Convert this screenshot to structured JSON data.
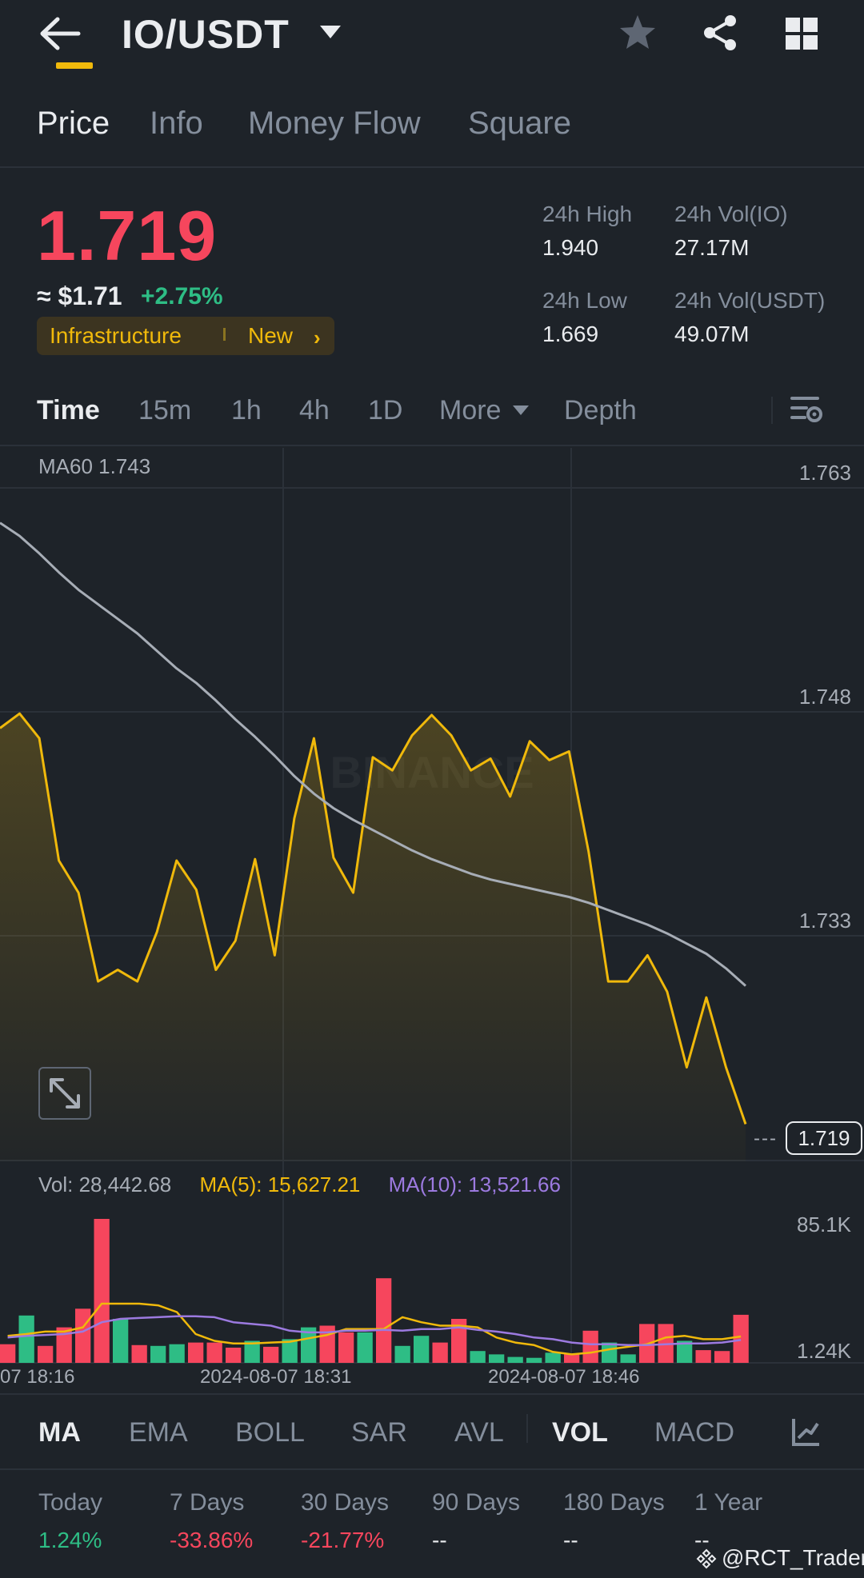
{
  "header": {
    "pair": "IO/USDT",
    "icons": [
      "back-arrow-icon",
      "caret-down-icon",
      "star-icon",
      "share-icon",
      "grid-icon"
    ]
  },
  "tabs": [
    {
      "label": "Price",
      "active": true
    },
    {
      "label": "Info",
      "active": false
    },
    {
      "label": "Money Flow",
      "active": false
    },
    {
      "label": "Square",
      "active": false
    }
  ],
  "ticker": {
    "last_price": "1.719",
    "usd_approx": "≈ $1.71",
    "change_pct": "+2.75%",
    "tag_category": "Infrastructure",
    "tag_new": "New",
    "high_label": "24h High",
    "high_value": "1.940",
    "low_label": "24h Low",
    "low_value": "1.669",
    "vol_io_label": "24h Vol(IO)",
    "vol_io_value": "27.17M",
    "vol_usdt_label": "24h Vol(USDT)",
    "vol_usdt_value": "49.07M"
  },
  "intervals": [
    {
      "label": "Time",
      "active": true
    },
    {
      "label": "15m",
      "active": false
    },
    {
      "label": "1h",
      "active": false
    },
    {
      "label": "4h",
      "active": false
    },
    {
      "label": "1D",
      "active": false
    },
    {
      "label": "More",
      "active": false
    },
    {
      "label": "Depth",
      "active": false
    }
  ],
  "chart_overlay": {
    "ma60_label": "MA60 1.743",
    "last_price_marker": "1.719",
    "watermark": "BINANCE"
  },
  "volume_legend": {
    "vol": "Vol: 28,442.68",
    "ma5": "MA(5): 15,627.21",
    "ma10": "MA(10): 13,521.66"
  },
  "indicators": {
    "main": [
      {
        "label": "MA",
        "active": true
      },
      {
        "label": "EMA",
        "active": false
      },
      {
        "label": "BOLL",
        "active": false
      },
      {
        "label": "SAR",
        "active": false
      },
      {
        "label": "AVL",
        "active": false
      }
    ],
    "sub": [
      {
        "label": "VOL",
        "active": true
      },
      {
        "label": "MACD",
        "active": false
      }
    ]
  },
  "performance": [
    {
      "label": "Today",
      "value": "1.24%",
      "color": "#2ebd85"
    },
    {
      "label": "7 Days",
      "value": "-33.86%",
      "color": "#f6465d"
    },
    {
      "label": "30 Days",
      "value": "-21.77%",
      "color": "#f6465d"
    },
    {
      "label": "90 Days",
      "value": "--",
      "color": "#eaecef"
    },
    {
      "label": "180 Days",
      "value": "--",
      "color": "#eaecef"
    },
    {
      "label": "1 Year",
      "value": "--",
      "color": "#eaecef"
    }
  ],
  "watermark_handle": "@RCT_Traders",
  "colors": {
    "up": "#2ebd85",
    "down": "#f6465d",
    "accent": "#f0b90b",
    "ma10": "#9c7ae0",
    "ma60": "#a7adb6",
    "background": "#1e2329"
  },
  "chart_data": [
    {
      "type": "area",
      "title": "",
      "ylim": [
        1.719,
        1.763
      ],
      "y_ticks": [
        "1.763",
        "1.748",
        "1.733",
        "1.719"
      ],
      "grid": true,
      "series": [
        {
          "name": "Price",
          "values": [
            1.7465,
            1.7475,
            1.7458,
            1.7374,
            1.7352,
            1.7291,
            1.7299,
            1.7291,
            1.7325,
            1.7374,
            1.7354,
            1.7299,
            1.7319,
            1.7375,
            1.7309,
            1.7403,
            1.7458,
            1.7376,
            1.7352,
            1.7445,
            1.7436,
            1.746,
            1.7474,
            1.746,
            1.7436,
            1.7444,
            1.7418,
            1.7456,
            1.7443,
            1.7449,
            1.738,
            1.7291,
            1.7291,
            1.7309,
            1.7284,
            1.7232,
            1.728,
            1.7232,
            1.7193
          ]
        },
        {
          "name": "MA60",
          "values": [
            1.7606,
            1.7597,
            1.7585,
            1.7572,
            1.756,
            1.755,
            1.754,
            1.753,
            1.7518,
            1.7506,
            1.7496,
            1.7484,
            1.7471,
            1.7459,
            1.7446,
            1.7432,
            1.742,
            1.741,
            1.7402,
            1.7395,
            1.7388,
            1.7381,
            1.7375,
            1.737,
            1.7365,
            1.7361,
            1.7358,
            1.7355,
            1.7352,
            1.7349,
            1.7345,
            1.734,
            1.7335,
            1.733,
            1.7324,
            1.7317,
            1.731,
            1.73,
            1.7288
          ]
        }
      ]
    },
    {
      "type": "bar",
      "title": "",
      "ylim": [
        1240,
        85100
      ],
      "y_ticks": [
        "85.1K",
        "1.24K"
      ],
      "x_tick_labels": [
        "07 18:16",
        "2024-08-07 18:31",
        "2024-08-07 18:46"
      ],
      "series": [
        {
          "name": "Vol",
          "values": [
            11000,
            28000,
            10000,
            21000,
            32000,
            85100,
            26000,
            10500,
            10000,
            11000,
            12000,
            12000,
            9000,
            13000,
            9500,
            14000,
            21000,
            22000,
            18000,
            18000,
            50000,
            10000,
            16000,
            12000,
            26000,
            7000,
            5000,
            3500,
            3000,
            6000,
            5000,
            19000,
            12000,
            5000,
            23000,
            23000,
            13000,
            7500,
            7000,
            28400
          ],
          "colors": [
            "#f6465d",
            "#2ebd85",
            "#f6465d",
            "#f6465d",
            "#f6465d",
            "#f6465d",
            "#2ebd85",
            "#f6465d",
            "#2ebd85",
            "#2ebd85",
            "#f6465d",
            "#f6465d",
            "#f6465d",
            "#2ebd85",
            "#f6465d",
            "#2ebd85",
            "#2ebd85",
            "#f6465d",
            "#f6465d",
            "#2ebd85",
            "#f6465d",
            "#2ebd85",
            "#2ebd85",
            "#f6465d",
            "#f6465d",
            "#2ebd85",
            "#2ebd85",
            "#2ebd85",
            "#2ebd85",
            "#2ebd85",
            "#f6465d",
            "#f6465d",
            "#2ebd85",
            "#2ebd85",
            "#f6465d",
            "#f6465d",
            "#2ebd85",
            "#f6465d",
            "#f6465d",
            "#f6465d"
          ]
        },
        {
          "name": "MA(5)",
          "values": [
            16000,
            17000,
            18500,
            18500,
            21000,
            35000,
            35000,
            35000,
            34000,
            30000,
            17000,
            13000,
            11500,
            11500,
            12000,
            12500,
            14500,
            16500,
            20000,
            20000,
            20000,
            27000,
            24000,
            22000,
            22000,
            21000,
            15000,
            12000,
            10500,
            6500,
            5000,
            6000,
            8000,
            9500,
            11000,
            15000,
            16000,
            14000,
            14000,
            15600
          ]
        },
        {
          "name": "MA(10)",
          "values": [
            15000,
            16000,
            16500,
            17000,
            18500,
            24000,
            26000,
            26500,
            27000,
            27500,
            27500,
            27000,
            24000,
            23000,
            22000,
            19000,
            18000,
            18000,
            19000,
            19000,
            19500,
            19000,
            20000,
            20000,
            21000,
            19500,
            18500,
            17000,
            15000,
            14000,
            12000,
            11000,
            11000,
            10500,
            10500,
            11000,
            11500,
            11500,
            12000,
            13500
          ]
        }
      ]
    }
  ]
}
